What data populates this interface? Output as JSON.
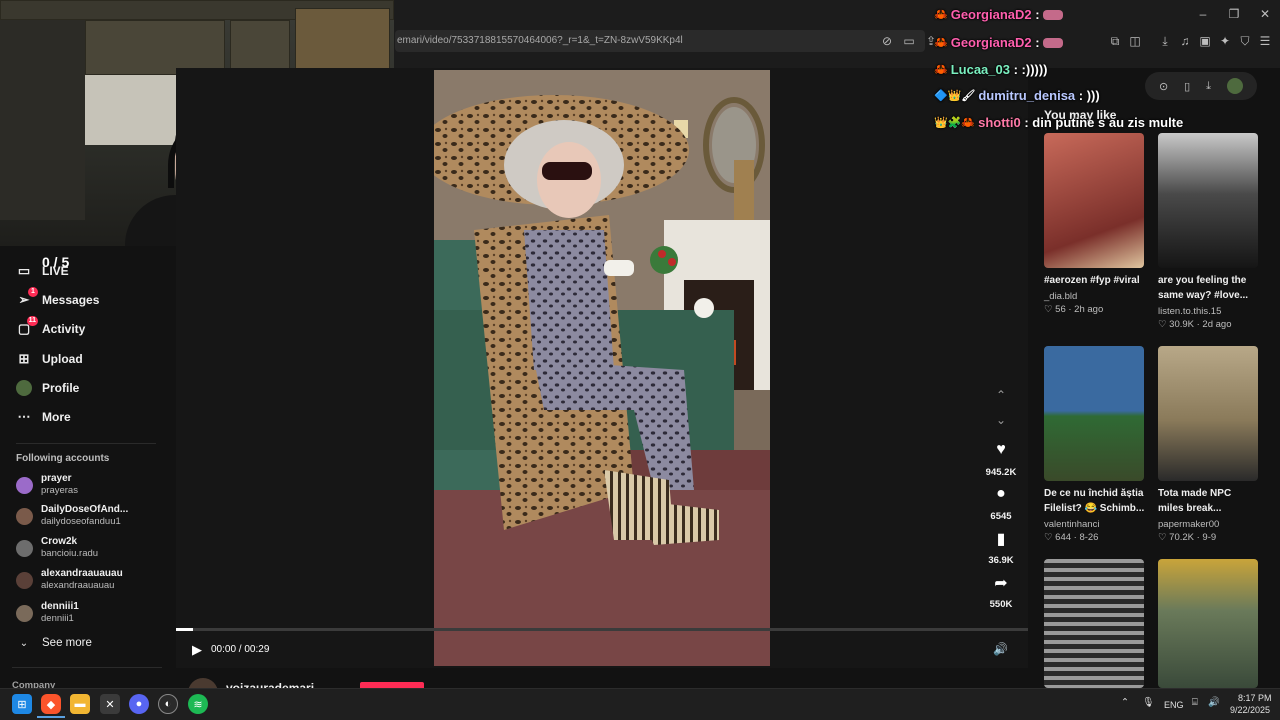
{
  "browser": {
    "url": "emari/video/7533718815570464006?_r=1&_t=ZN-8zwV59KKp4l",
    "window_controls": [
      "–",
      "❐",
      "✕"
    ]
  },
  "overlay": {
    "counter": "0 / 5"
  },
  "nav": {
    "items": [
      {
        "label": "LIVE",
        "icon": "live-icon"
      },
      {
        "label": "Messages",
        "icon": "messages-icon",
        "badge": "1"
      },
      {
        "label": "Activity",
        "icon": "activity-icon",
        "badge": "11"
      },
      {
        "label": "Upload",
        "icon": "upload-icon"
      },
      {
        "label": "Profile",
        "icon": "profile-avatar"
      },
      {
        "label": "More",
        "icon": "more-icon"
      }
    ],
    "following_title": "Following accounts",
    "accounts": [
      {
        "name": "prayer",
        "handle": "prayeras",
        "color": "#9b6bc9"
      },
      {
        "name": "DailyDoseOfAnd...",
        "handle": "dailydoseofanduu1",
        "color": "#7a5a4a"
      },
      {
        "name": "Crow2k",
        "handle": "bancioiu.radu",
        "color": "#6d6d6d"
      },
      {
        "name": "alexandraauauau",
        "handle": "alexandraauauau",
        "color": "#5a4038"
      },
      {
        "name": "denniii1",
        "handle": "denniii1",
        "color": "#7a6a5a"
      }
    ],
    "see_more": "See more",
    "company": "Company"
  },
  "player": {
    "time": "00:00 / 00:29",
    "progress": 0.02,
    "author": "voizaurademari",
    "actions": [
      {
        "icon": "heart-icon",
        "count": "945.2K"
      },
      {
        "icon": "comment-icon",
        "count": "6545"
      },
      {
        "icon": "bookmark-icon",
        "count": "36.9K"
      },
      {
        "icon": "share-icon",
        "count": "550K"
      }
    ]
  },
  "chat": [
    {
      "icons": "🦀",
      "user": "GeorgianaD2",
      "msg": "",
      "color": "#ff5fae"
    },
    {
      "icons": "🦀",
      "user": "GeorgianaD2",
      "msg": "",
      "color": "#ff5fae"
    },
    {
      "icons": "🦀",
      "user": "Lucaa_03",
      "msg": ":)))))",
      "color": "#7bf0c0"
    },
    {
      "icons": "🔷👑🖌",
      "user": "dumitru_denisa",
      "msg": ")))",
      "color": "#b9c8ff"
    },
    {
      "icons": "👑🧩🦀",
      "user": "shotti0",
      "msg": "din putine s au zis multe",
      "color": "#ff7aa8"
    }
  ],
  "recommend": {
    "title": "You may like",
    "videos": [
      {
        "caption": "#aerozen #fyp #viral",
        "caption2": "",
        "author": "_dia.bld",
        "stats": "♡ 56 · 2h ago",
        "c1": "#b24a3a",
        "c2": "#7a2f2a"
      },
      {
        "caption": "are you feeling the",
        "caption2": "same way? #love...",
        "author": "listen.to.this.15",
        "stats": "♡ 30.9K · 2d ago",
        "c1": "#3b3b3b",
        "c2": "#1d1d1d"
      },
      {
        "caption": "De ce nu închid ăștia",
        "caption2": "Filelist? 😂 Schimb...",
        "author": "valentinhanci",
        "stats": "♡ 644 · 8-26",
        "c1": "#2c6a3a",
        "c2": "#3a3f2a"
      },
      {
        "caption": "Tota made NPC",
        "caption2": "miles break...",
        "author": "papermaker00",
        "stats": "♡ 70.2K · 9-9",
        "c1": "#9a8a6a",
        "c2": "#5b4b3a"
      },
      {
        "caption": "",
        "caption2": "",
        "author": "",
        "stats": "",
        "c1": "#8a8a8a",
        "c2": "#2a2a2a"
      },
      {
        "caption": "",
        "caption2": "",
        "author": "",
        "stats": "",
        "c1": "#c9a43a",
        "c2": "#4a5a4a"
      }
    ]
  },
  "taskbar": {
    "lang": "ENG",
    "time": "8:17 PM",
    "date": "9/22/2025"
  }
}
